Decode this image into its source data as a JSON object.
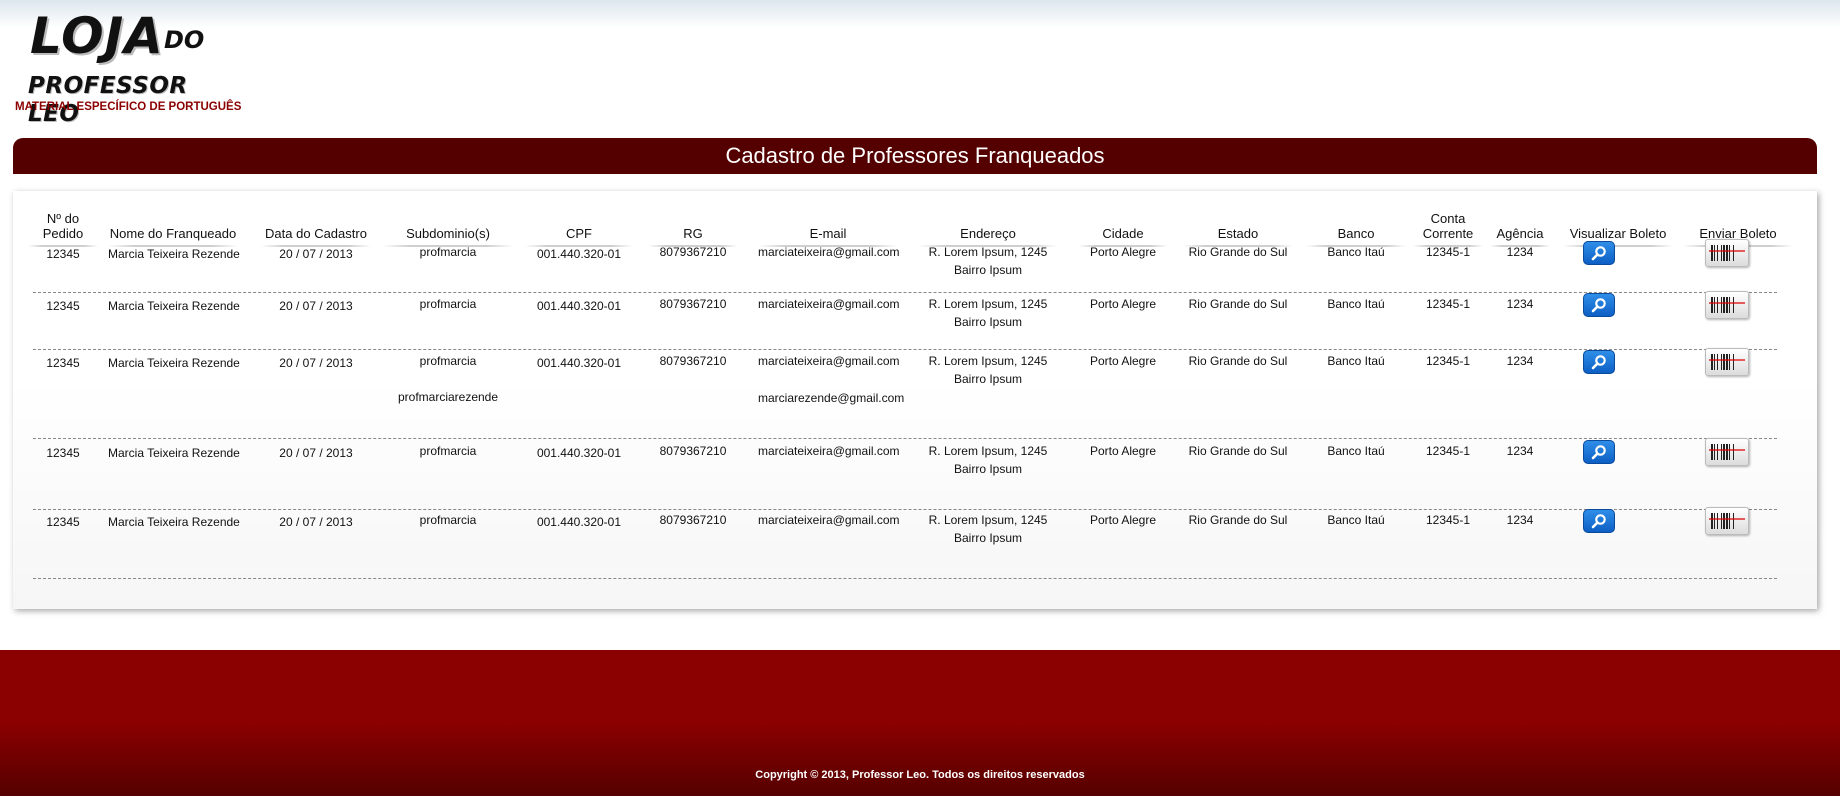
{
  "logo": {
    "line1": "LOJA",
    "line1_suffix": "DO",
    "line2": "PROFESSOR LEO",
    "tagline": "MATERIAL ESPECÍFICO DE PORTUGUÊS"
  },
  "page_title": "Cadastro de Professores Franqueados",
  "table": {
    "headers": [
      "Nº do Pedido",
      "Nome do Franqueado",
      "Data do Cadastro",
      "Subdominio(s)",
      "CPF",
      "RG",
      "E-mail",
      "Endereço",
      "Cidade",
      "Estado",
      "Banco",
      "Conta Corrente",
      "Agência",
      "Visualizar Boleto",
      "Enviar Boleto"
    ],
    "rows": [
      {
        "pedido": "12345",
        "nome": "Marcia Teixeira Rezende",
        "data": "20 / 07 / 2013",
        "subdominio": "profmarcia",
        "subdominio2": "",
        "cpf": "001.440.320-01",
        "rg": "8079367210",
        "email": "marciateixeira@gmail.com",
        "email2": "",
        "endereco1": "R. Lorem Ipsum, 1245",
        "endereco2": "Bairro Ipsum",
        "cidade": "Porto Alegre",
        "estado": "Rio Grande do Sul",
        "banco": "Banco Itaú",
        "conta": "12345-1",
        "agencia": "1234"
      },
      {
        "pedido": "12345",
        "nome": "Marcia Teixeira Rezende",
        "data": "20 / 07 / 2013",
        "subdominio": "profmarcia",
        "subdominio2": "",
        "cpf": "001.440.320-01",
        "rg": "8079367210",
        "email": "marciateixeira@gmail.com",
        "email2": "",
        "endereco1": "R. Lorem Ipsum, 1245",
        "endereco2": "Bairro Ipsum",
        "cidade": "Porto Alegre",
        "estado": "Rio Grande do Sul",
        "banco": "Banco Itaú",
        "conta": "12345-1",
        "agencia": "1234"
      },
      {
        "pedido": "12345",
        "nome": "Marcia Teixeira Rezende",
        "data": "20 / 07 / 2013",
        "subdominio": "profmarcia",
        "subdominio2": "profmarciarezende",
        "cpf": "001.440.320-01",
        "rg": "8079367210",
        "email": "marciateixeira@gmail.com",
        "email2": "marciarezende@gmail.com",
        "endereco1": "R. Lorem Ipsum, 1245",
        "endereco2": "Bairro Ipsum",
        "cidade": "Porto Alegre",
        "estado": "Rio Grande do Sul",
        "banco": "Banco Itaú",
        "conta": "12345-1",
        "agencia": "1234"
      },
      {
        "pedido": "12345",
        "nome": "Marcia Teixeira Rezende",
        "data": "20 / 07 / 2013",
        "subdominio": "profmarcia",
        "subdominio2": "",
        "cpf": "001.440.320-01",
        "rg": "8079367210",
        "email": "marciateixeira@gmail.com",
        "email2": "",
        "endereco1": "R. Lorem Ipsum, 1245",
        "endereco2": "Bairro Ipsum",
        "cidade": "Porto Alegre",
        "estado": "Rio Grande do Sul",
        "banco": "Banco Itaú",
        "conta": "12345-1",
        "agencia": "1234"
      },
      {
        "pedido": "12345",
        "nome": "Marcia Teixeira Rezende",
        "data": "20 / 07 / 2013",
        "subdominio": "profmarcia",
        "subdominio2": "",
        "cpf": "001.440.320-01",
        "rg": "8079367210",
        "email": "marciateixeira@gmail.com",
        "email2": "",
        "endereco1": "R. Lorem Ipsum, 1245",
        "endereco2": "Bairro Ipsum",
        "cidade": "Porto Alegre",
        "estado": "Rio Grande do Sul",
        "banco": "Banco Itaú",
        "conta": "12345-1",
        "agencia": "1234"
      }
    ],
    "view_icon": "magnifier-icon",
    "send_icon": "barcode-icon"
  },
  "colors": {
    "brand_dark_red": "#550000",
    "brand_red": "#8b0000",
    "button_blue": "#1a72d6"
  },
  "footer": {
    "copyright": "Copyright © 2013, Professor Leo. Todos os direitos reservados"
  }
}
